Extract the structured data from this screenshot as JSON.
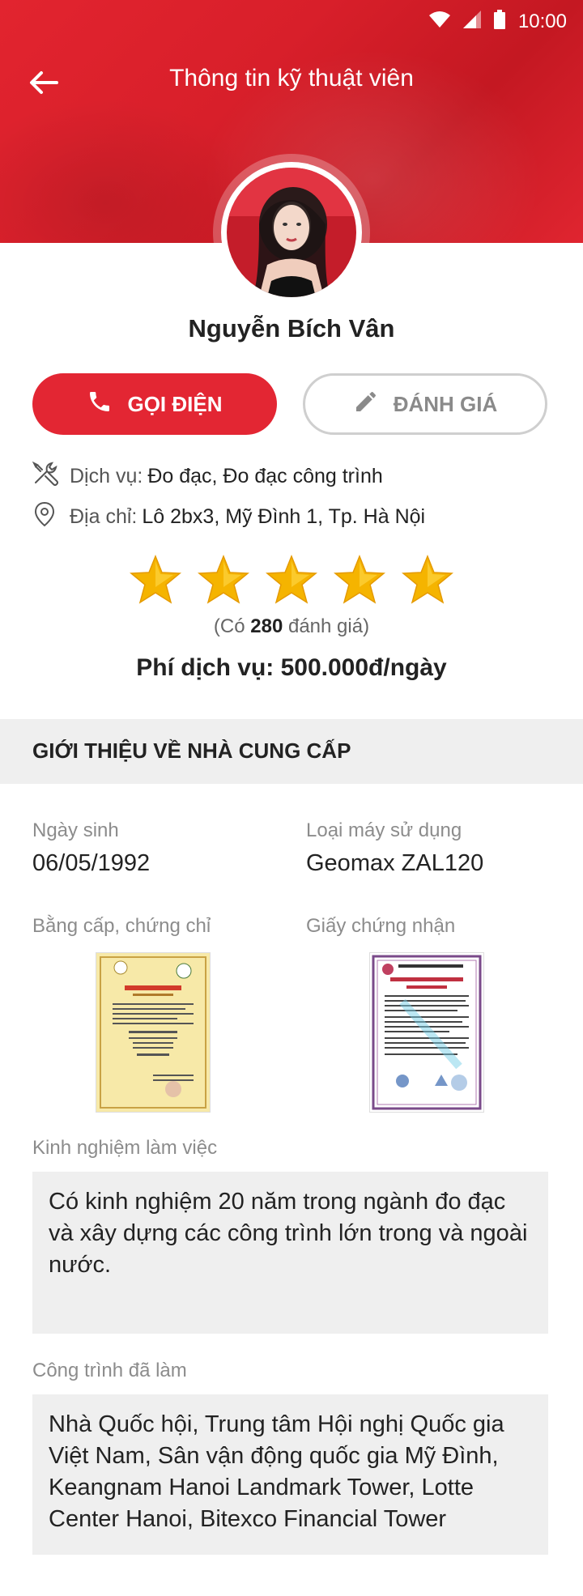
{
  "status_bar": {
    "time": "10:00"
  },
  "header": {
    "title": "Thông tin kỹ thuật viên"
  },
  "profile": {
    "name": "Nguyễn Bích Vân"
  },
  "actions": {
    "call_label": "GỌI ĐIỆN",
    "rate_label": "ĐÁNH GIÁ"
  },
  "info": {
    "service_label": "Dịch vụ:",
    "service_value": "Đo đạc, Đo đạc công trình",
    "address_label": "Địa chỉ:",
    "address_value": "Lô 2bx3, Mỹ Đình 1, Tp. Hà Nội"
  },
  "rating": {
    "stars": 5,
    "text_prefix": "(Có ",
    "count": "280",
    "text_suffix": " đánh giá)"
  },
  "price": {
    "text": "Phí dịch vụ: 500.000đ/ngày"
  },
  "section": {
    "title": "GIỚI THIỆU VỀ NHÀ CUNG CẤP"
  },
  "details": {
    "birthday_label": "Ngày sinh",
    "birthday_value": "06/05/1992",
    "machine_label": "Loại máy sử dụng",
    "machine_value": "Geomax ZAL120",
    "degree_label": "Bằng cấp, chứng chỉ",
    "certificate_label": "Giấy chứng nhận",
    "experience_label": "Kinh nghiệm làm việc",
    "experience_text": "Có kinh nghiệm 20 năm trong ngành đo đạc và xây dựng các công trình lớn trong và ngoài nước.",
    "projects_label": "Công trình đã làm",
    "projects_text": "Nhà Quốc hội, Trung tâm Hội nghị Quốc gia Việt Nam, Sân vận động quốc gia Mỹ Đình, Keangnam Hanoi Landmark Tower, Lotte Center Hanoi, Bitexco Financial Tower"
  },
  "colors": {
    "accent": "#e32633",
    "section_bg": "#efefef",
    "star": "#f5b400"
  }
}
